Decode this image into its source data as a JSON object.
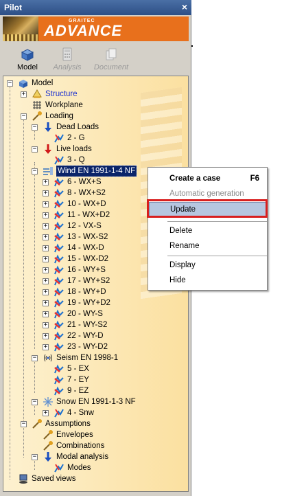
{
  "window": {
    "title": "Pilot",
    "close": "×"
  },
  "banner": {
    "brand_small": "GRAITEC",
    "brand": "ADVANCE"
  },
  "tabs": [
    {
      "label": "Model",
      "icon": "model-icon",
      "active": true
    },
    {
      "label": "Analysis",
      "icon": "calculator-icon",
      "active": false
    },
    {
      "label": "Document",
      "icon": "document-icon",
      "active": false
    }
  ],
  "tree": {
    "root": "Model",
    "structure": "Structure",
    "workplane": "Workplane",
    "loading": "Loading",
    "dead_loads": "Dead Loads",
    "dead_g": "2 - G",
    "live_loads": "Live loads",
    "live_q": "3 - Q",
    "wind": "Wind EN 1991-1-4 NF",
    "wind_cases": [
      "6 - WX+S",
      "8 - WX+S2",
      "10 - WX+D",
      "11 - WX+D2",
      "12 - VX-S",
      "13 - WX-S2",
      "14 - WX-D",
      "15 - WX-D2",
      "16 - WY+S",
      "17 - WY+S2",
      "18 - WY+D",
      "19 - WY+D2",
      "20 - WY-S",
      "21 - WY-S2",
      "22 - WY-D",
      "23 - WY-D2"
    ],
    "seism": "Seism EN 1998-1",
    "seism_cases": [
      "5 - EX",
      "7 - EY",
      "9 - EZ"
    ],
    "snow": "Snow EN 1991-1-3 NF",
    "snow_case": "4 - Snw",
    "assumptions": "Assumptions",
    "envelopes": "Envelopes",
    "combinations": "Combinations",
    "modal": "Modal analysis",
    "modes": "Modes",
    "saved_views": "Saved views"
  },
  "context_menu": {
    "create_case": "Create a case",
    "create_case_shortcut": "F6",
    "automatic_generation": "Automatic generation",
    "update": "Update",
    "delete": "Delete",
    "rename": "Rename",
    "display": "Display",
    "hide": "Hide"
  },
  "colors": {
    "highlight_border": "#d81e1e",
    "selection": "#0a246a",
    "banner": "#e8701c"
  }
}
